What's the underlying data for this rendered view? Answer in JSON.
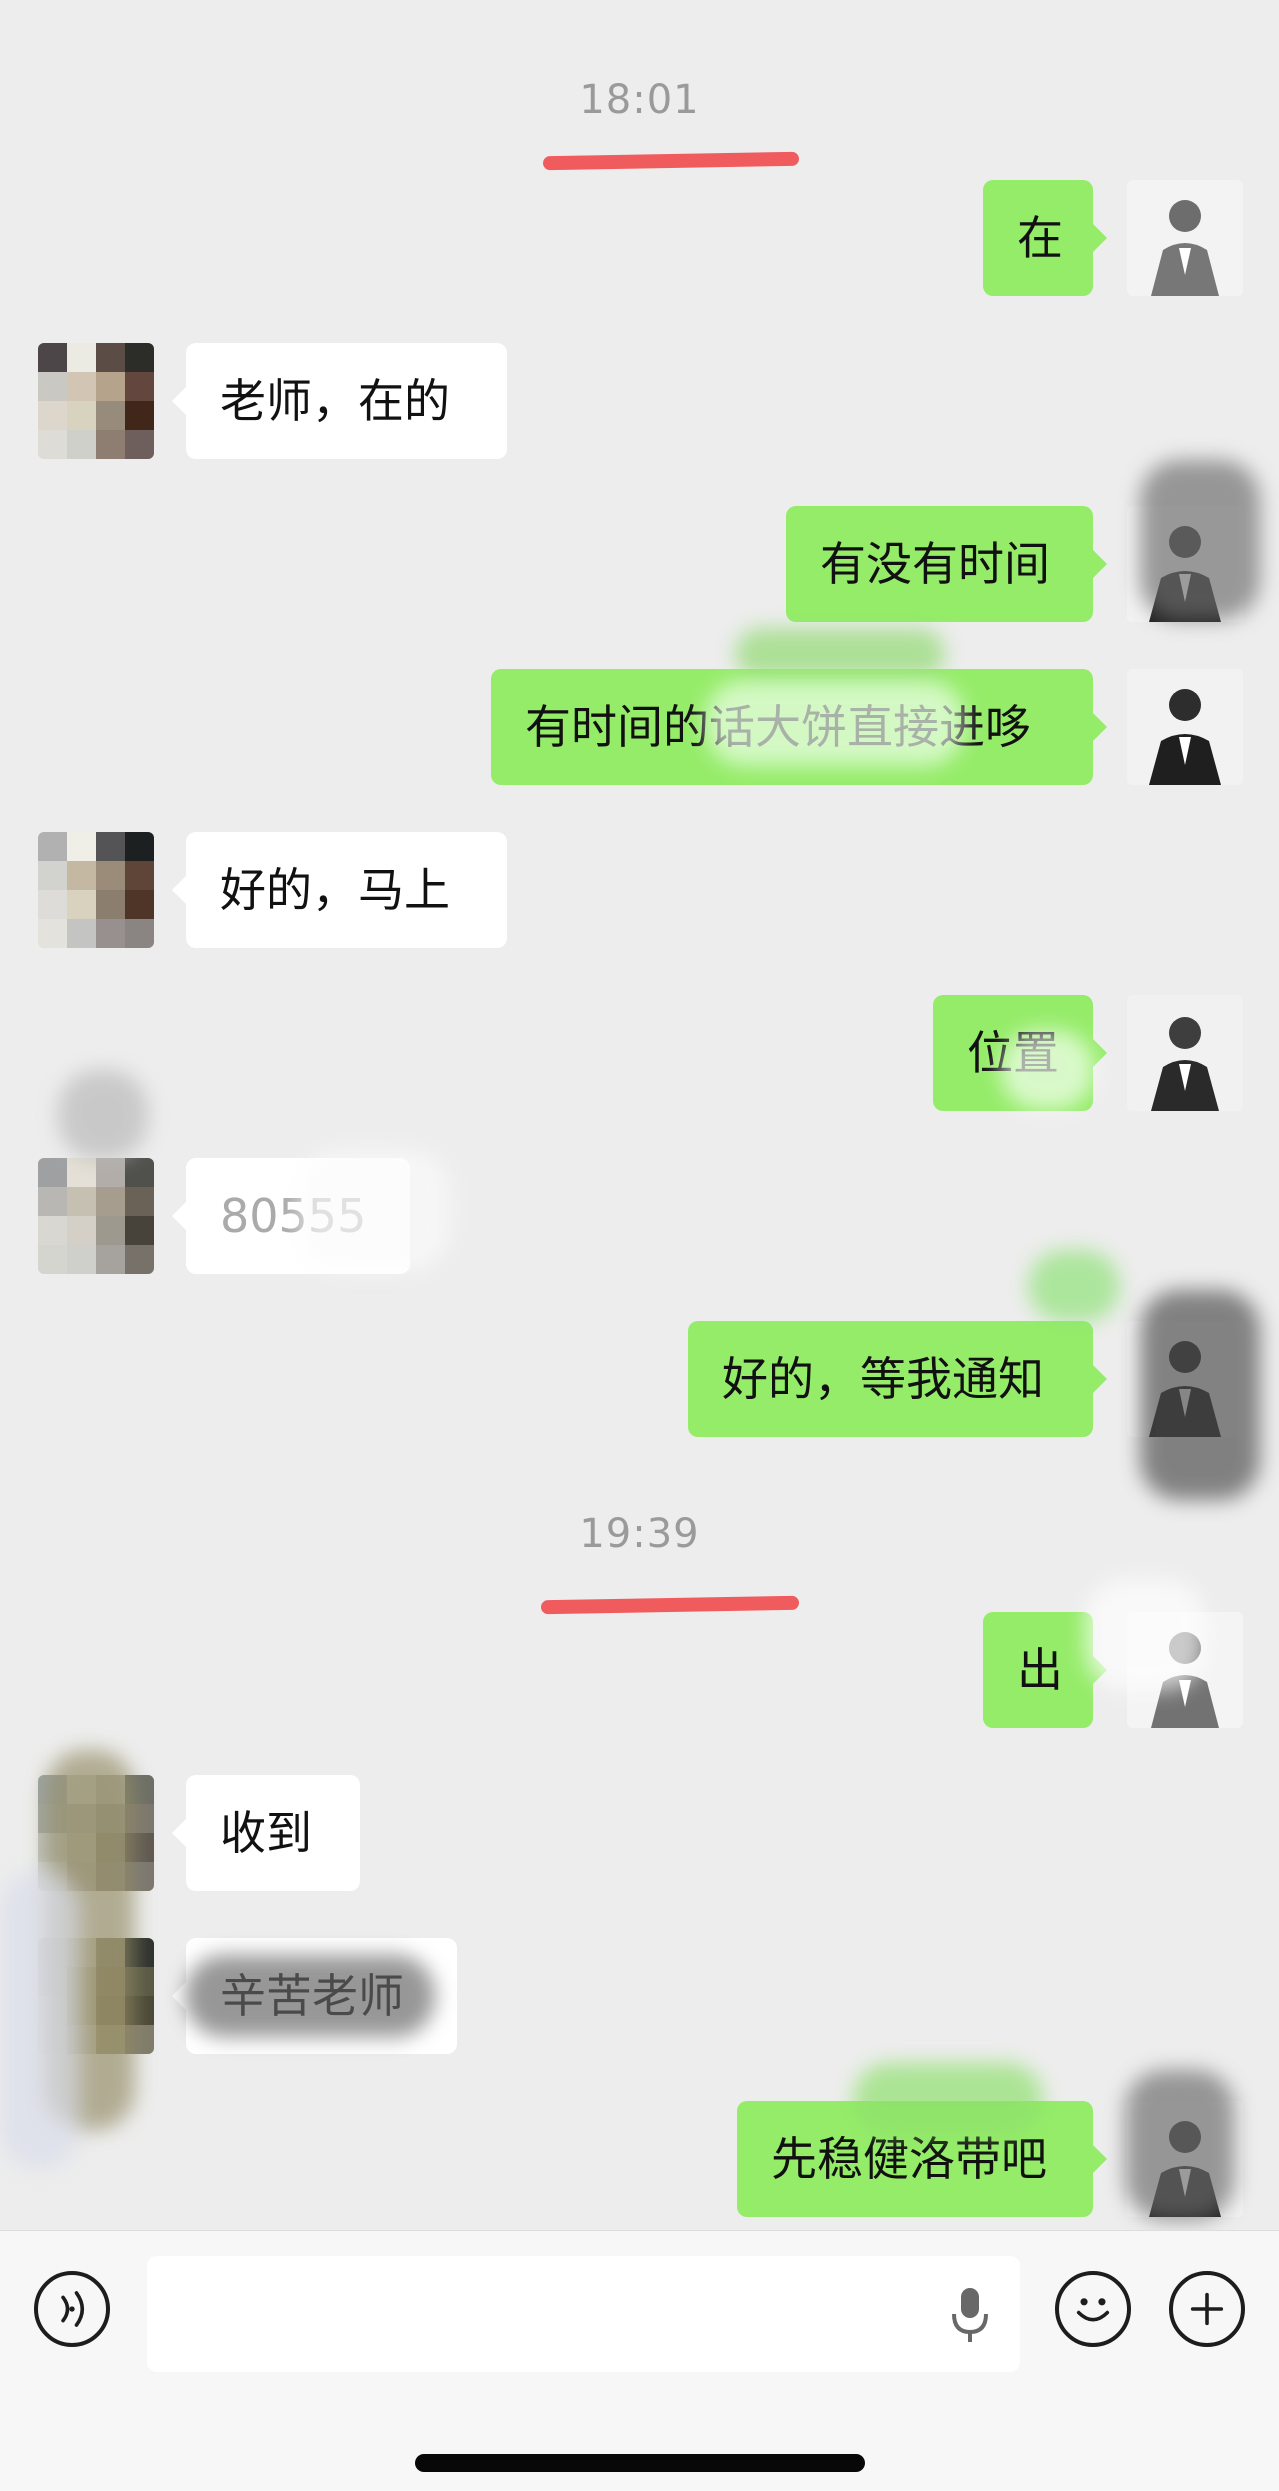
{
  "chat": {
    "timestamps": [
      "18:01",
      "19:39"
    ],
    "messages": [
      {
        "side": "right",
        "text": "在"
      },
      {
        "side": "left",
        "text": "老师，在的"
      },
      {
        "side": "right",
        "text": "有没有时间"
      },
      {
        "side": "right",
        "text": "有时间的话大饼直接进哆"
      },
      {
        "side": "left",
        "text": "好的，马上"
      },
      {
        "side": "right",
        "text": "位置"
      },
      {
        "side": "left",
        "text": "80555"
      },
      {
        "side": "right",
        "text": "好的，等我通知"
      },
      {
        "side": "right",
        "text": "出"
      },
      {
        "side": "left",
        "text": "收到"
      },
      {
        "side": "left",
        "text": "辛苦老师"
      },
      {
        "side": "right",
        "text": "先稳健洛带吧"
      }
    ]
  },
  "toolbar": {
    "voice_icon": "voice-icon",
    "mic_icon": "microphone-icon",
    "emoji_icon": "emoji-icon",
    "plus_icon": "plus-icon"
  },
  "colors": {
    "background": "#ededed",
    "bubble_right": "#95ec69",
    "bubble_left": "#ffffff",
    "timestamp_text": "#9a9a9a",
    "underline": "#f0474a"
  }
}
